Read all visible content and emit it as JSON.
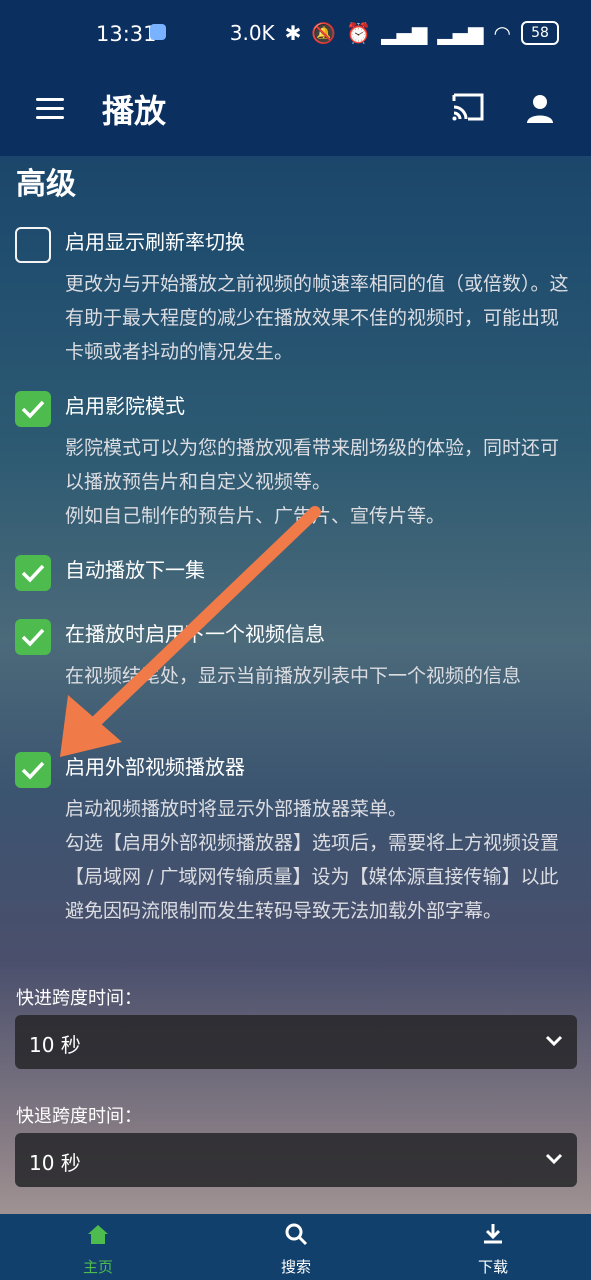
{
  "statusbar": {
    "time": "13:31",
    "network_speed": "3.0K",
    "battery": "58"
  },
  "header": {
    "title": "播放"
  },
  "section": {
    "title": "高级"
  },
  "settings": [
    {
      "title": "启用显示刷新率切换",
      "checked": false,
      "desc": [
        "更改为与开始播放之前视频的帧速率相同的值（或倍数）。这有助于最大程度的减少在播放效果不佳的视频时，可能出现卡顿或者抖动的情况发生。"
      ]
    },
    {
      "title": "启用影院模式",
      "checked": true,
      "desc": [
        "影院模式可以为您的播放观看带来剧场级的体验，同时还可以播放预告片和自定义视频等。",
        "例如自己制作的预告片、广告片、宣传片等。"
      ]
    },
    {
      "title": "自动播放下一集",
      "checked": true,
      "desc": []
    },
    {
      "title": "在播放时启用下一个视频信息",
      "checked": true,
      "desc": [
        "在视频结尾处，显示当前播放列表中下一个视频的信息"
      ]
    },
    {
      "title": "启用外部视频播放器",
      "checked": true,
      "desc": [
        "启动视频播放时将显示外部播放器菜单。",
        "勾选【启用外部视频播放器】选项后，需要将上方视频设置【局域网 / 广域网传输质量】设为【媒体源直接传输】以此避免因码流限制而发生转码导致无法加载外部字幕。"
      ]
    }
  ],
  "forward": {
    "label": "快进跨度时间：",
    "value": "10 秒"
  },
  "rewind": {
    "label": "快退跨度时间：",
    "value": "10 秒"
  },
  "bottom_nav": [
    {
      "label": "主页",
      "icon": "home-icon",
      "active": true
    },
    {
      "label": "搜索",
      "icon": "search-icon",
      "active": false
    },
    {
      "label": "下载",
      "icon": "download-icon",
      "active": false
    }
  ],
  "colors": {
    "accent": "#4dbb4d",
    "annotation_arrow": "#f07a48"
  }
}
